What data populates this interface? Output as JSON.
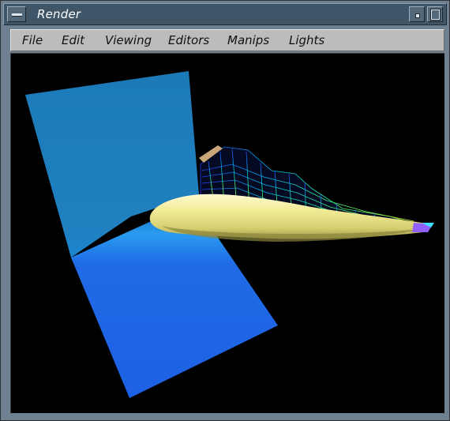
{
  "window": {
    "title": "Render"
  },
  "menubar": {
    "items": [
      "File",
      "Edit",
      "Viewing",
      "Editors",
      "Manips",
      "Lights"
    ]
  },
  "scene": {
    "objects": [
      "vertical-plane",
      "horizontal-plane",
      "wireframe-wing",
      "fuselage-body"
    ],
    "colors": {
      "background": "#000000",
      "plane_vertical": "#1f7fb8",
      "plane_horizontal": "#1f5fe0",
      "fuselage": "#f4f0a0",
      "wireframe": [
        "#2040ff",
        "#00c8ff",
        "#30ff90",
        "#e0ff40"
      ]
    }
  }
}
